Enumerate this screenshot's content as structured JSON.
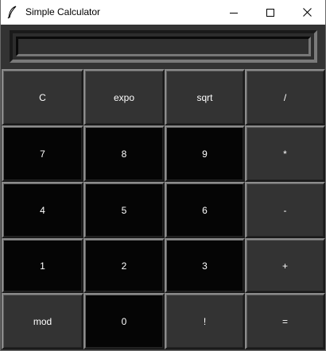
{
  "window": {
    "title": "Simple Calculator",
    "controls": {
      "minimize": "minimize-icon",
      "maximize": "maximize-icon",
      "close": "close-icon"
    }
  },
  "display": {
    "value": ""
  },
  "keys": {
    "row0": [
      "C",
      "expo",
      "sqrt",
      "/"
    ],
    "row1": [
      "7",
      "8",
      "9",
      "*"
    ],
    "row2": [
      "4",
      "5",
      "6",
      "-"
    ],
    "row3": [
      "1",
      "2",
      "3",
      "+"
    ],
    "row4": [
      "mod",
      "0",
      "!",
      "="
    ]
  },
  "colors": {
    "window_bg": "#333333",
    "digit_key_bg": "#050505",
    "function_key_bg": "#333333",
    "key_text": "#ffffff"
  }
}
